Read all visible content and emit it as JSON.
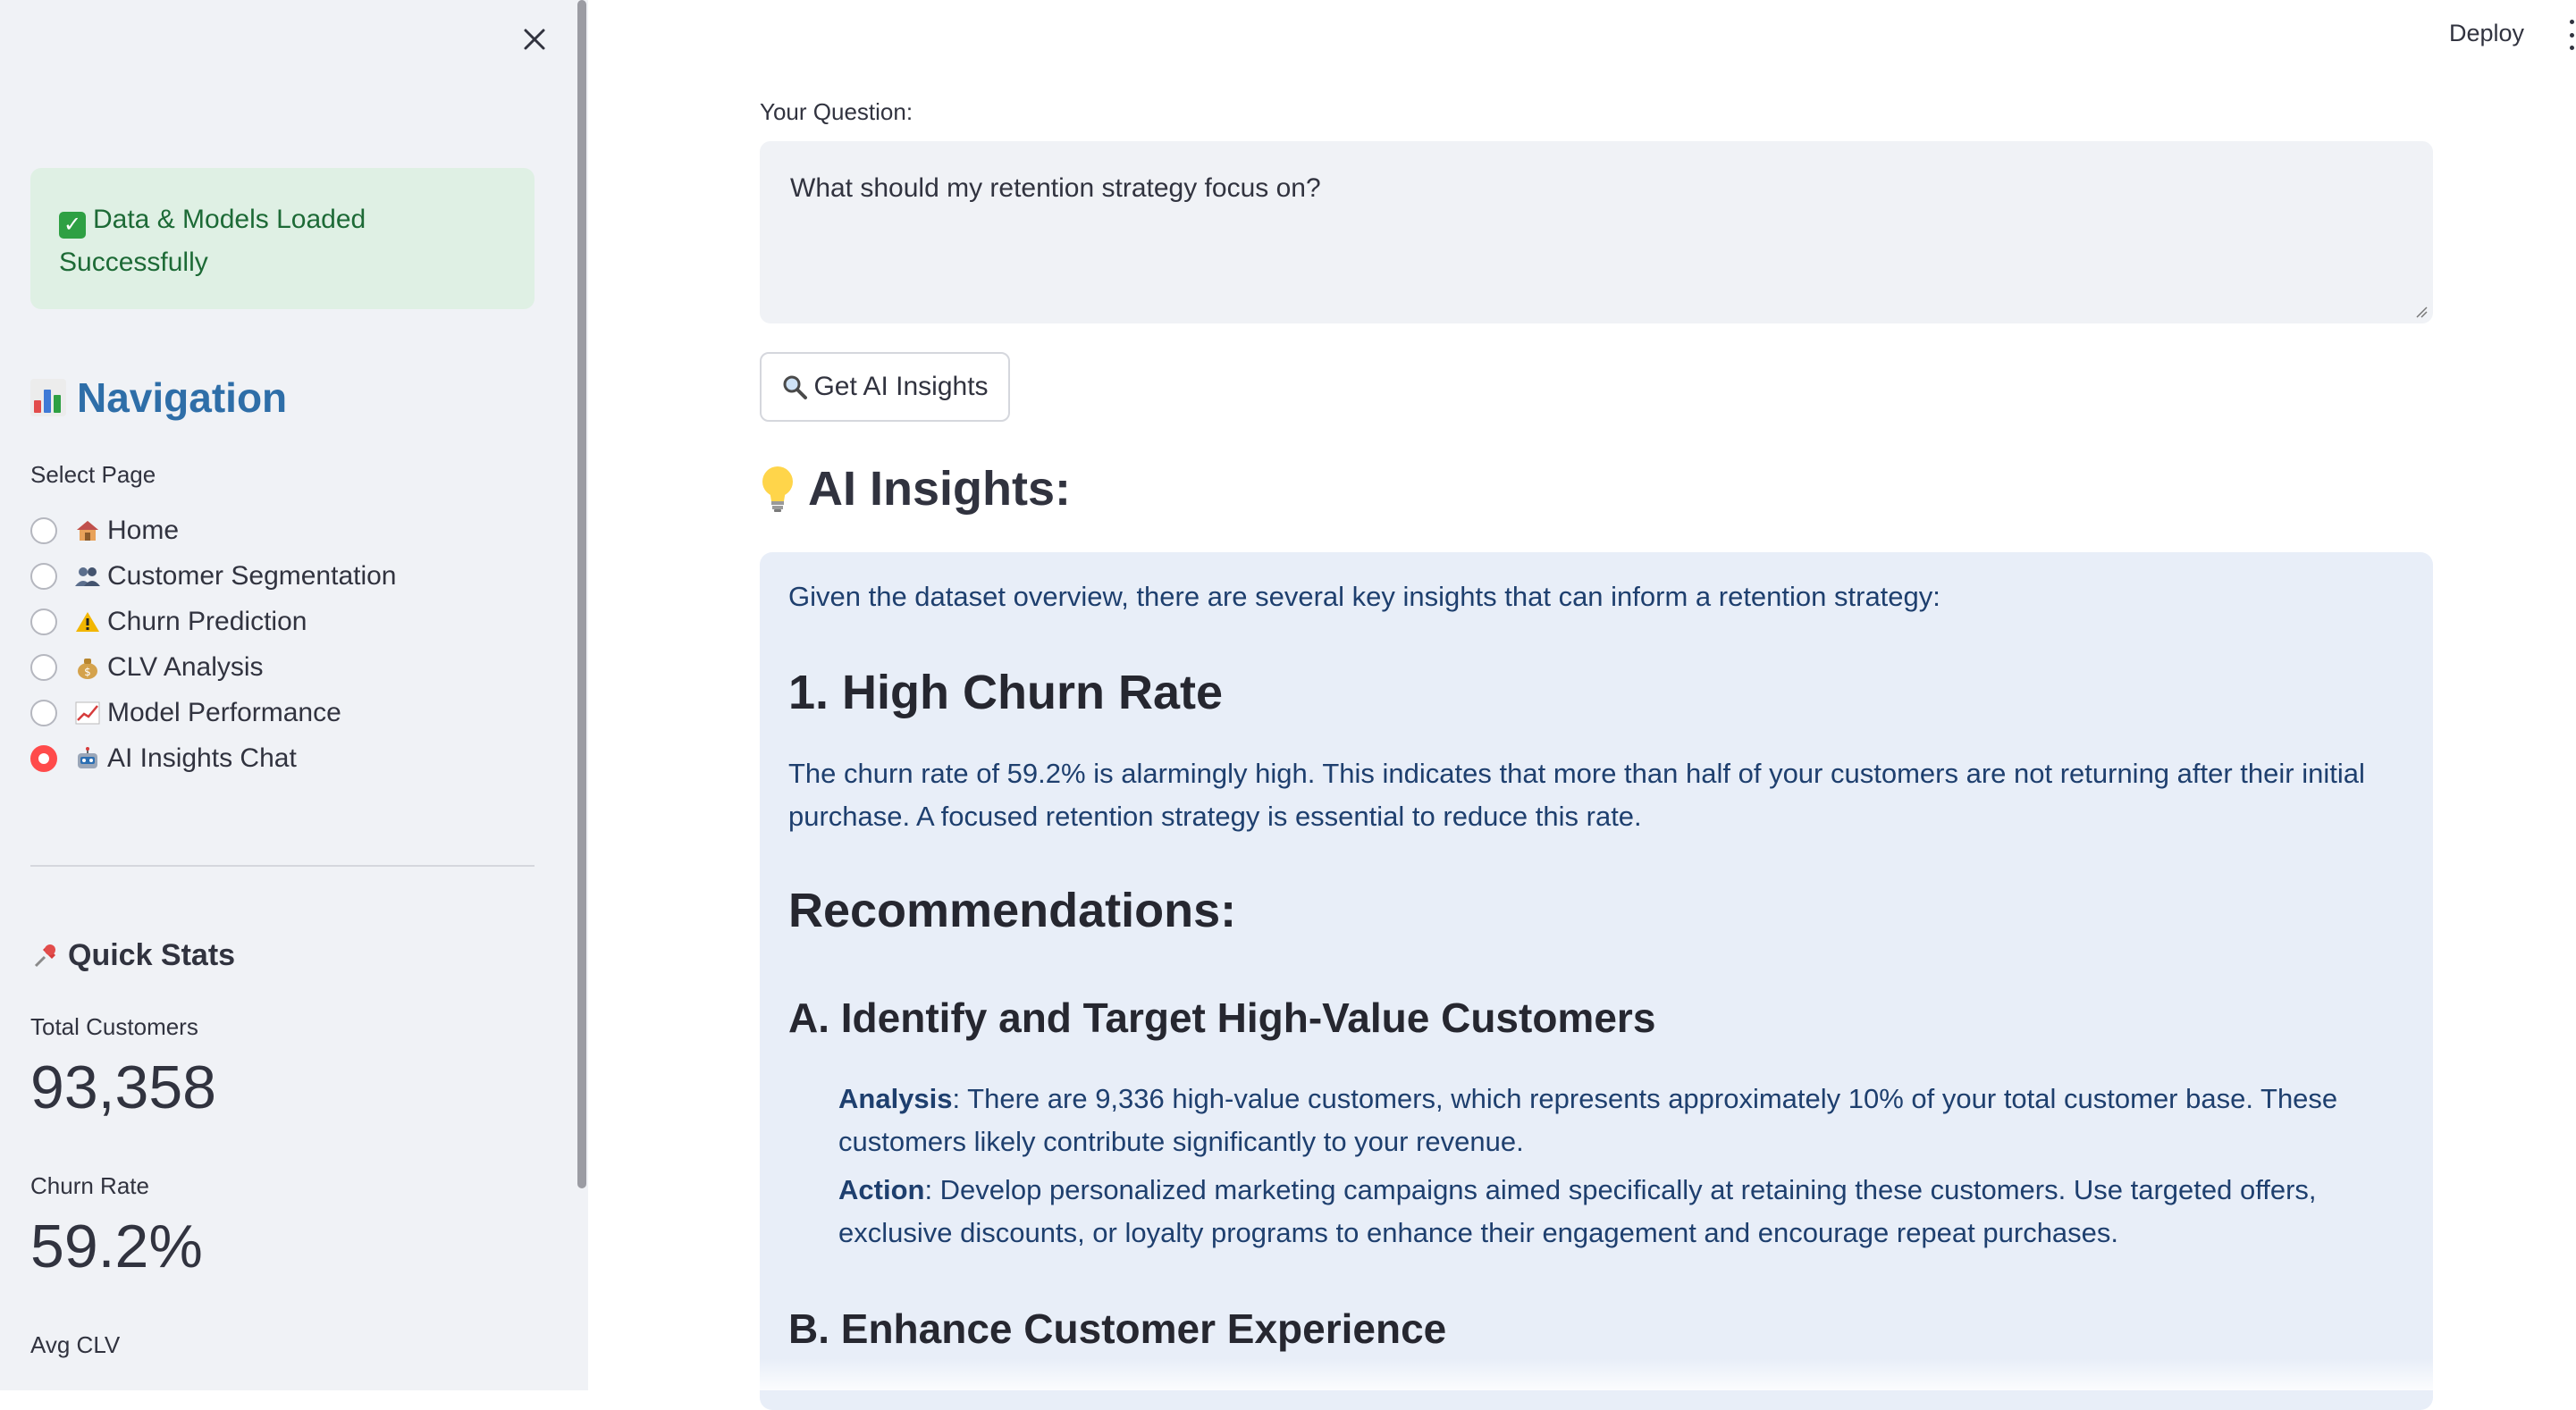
{
  "sidebar": {
    "status_message": "Data & Models Loaded Successfully",
    "nav_title": "Navigation",
    "select_label": "Select Page",
    "pages": [
      {
        "label": "Home",
        "icon": "house-icon",
        "selected": false
      },
      {
        "label": "Customer Segmentation",
        "icon": "people-icon",
        "selected": false
      },
      {
        "label": "Churn Prediction",
        "icon": "warning-icon",
        "selected": false
      },
      {
        "label": "CLV Analysis",
        "icon": "money-bag-icon",
        "selected": false
      },
      {
        "label": "Model Performance",
        "icon": "chart-up-icon",
        "selected": false
      },
      {
        "label": "AI Insights Chat",
        "icon": "robot-icon",
        "selected": true
      }
    ],
    "quick_stats_title": "Quick Stats",
    "stats": [
      {
        "label": "Total Customers",
        "value": "93,358"
      },
      {
        "label": "Churn Rate",
        "value": "59.2%"
      },
      {
        "label": "Avg CLV",
        "value": ""
      }
    ]
  },
  "header": {
    "deploy_label": "Deploy"
  },
  "main": {
    "question_label": "Your Question:",
    "question_value": "What should my retention strategy focus on?",
    "button_label": "Get AI Insights",
    "insights_heading": "AI Insights:",
    "response": {
      "intro": "Given the dataset overview, there are several key insights that can inform a retention strategy:",
      "section1_title": "1. High Churn Rate",
      "section1_text": "The churn rate of 59.2% is alarmingly high. This indicates that more than half of your customers are not returning after their initial purchase. A focused retention strategy is essential to reduce this rate.",
      "recommendations_title": "Recommendations:",
      "subA_title": "A. Identify and Target High-Value Customers",
      "subA_analysis_label": "Analysis",
      "subA_analysis_text": ": There are 9,336 high-value customers, which represents approximately 10% of your total customer base. These customers likely contribute significantly to your revenue.",
      "subA_action_label": "Action",
      "subA_action_text": ": Develop personalized marketing campaigns aimed specifically at retaining these customers. Use targeted offers, exclusive discounts, or loyalty programs to enhance their engagement and encourage repeat purchases.",
      "subB_title": "B. Enhance Customer Experience"
    }
  },
  "colors": {
    "accent_radio": "#ff4b4b",
    "nav_title": "#2e6ea8",
    "success_bg": "#dff0e4",
    "info_bg": "#e8eef8"
  }
}
